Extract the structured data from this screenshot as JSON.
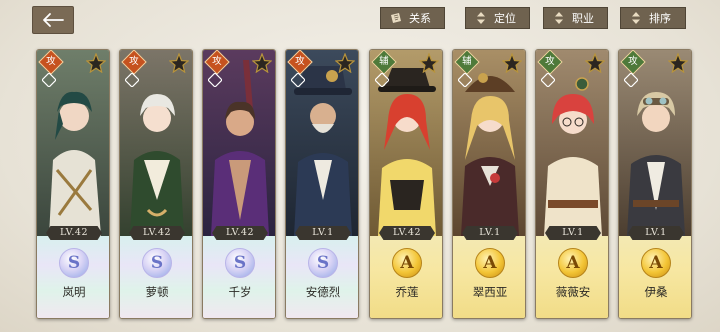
{
  "header": {
    "back_icon": "arrow-left-icon",
    "relation_label": "关系",
    "position_label": "定位",
    "job_label": "职业",
    "sort_label": "排序"
  },
  "colors": {
    "attack_badge": "#c6521f",
    "support_badge": "#4e7a3a",
    "panel_button": "#6f624f"
  },
  "cards": [
    {
      "name": "岚明",
      "level": "LV.42",
      "rank": "S",
      "role": "攻",
      "theme": "s"
    },
    {
      "name": "萝顿",
      "level": "LV.42",
      "rank": "S",
      "role": "攻",
      "theme": "s"
    },
    {
      "name": "千岁",
      "level": "LV.42",
      "rank": "S",
      "role": "攻",
      "theme": "s"
    },
    {
      "name": "安德烈",
      "level": "LV.1",
      "rank": "S",
      "role": "攻",
      "theme": "s"
    },
    {
      "name": "乔莲",
      "level": "LV.42",
      "rank": "A",
      "role": "辅",
      "theme": "a"
    },
    {
      "name": "翠西亚",
      "level": "LV.1",
      "rank": "A",
      "role": "辅",
      "theme": "a"
    },
    {
      "name": "薇薇安",
      "level": "LV.1",
      "rank": "A",
      "role": "攻",
      "theme": "a"
    },
    {
      "name": "伊桑",
      "level": "LV.1",
      "rank": "A",
      "role": "攻",
      "theme": "a"
    }
  ]
}
